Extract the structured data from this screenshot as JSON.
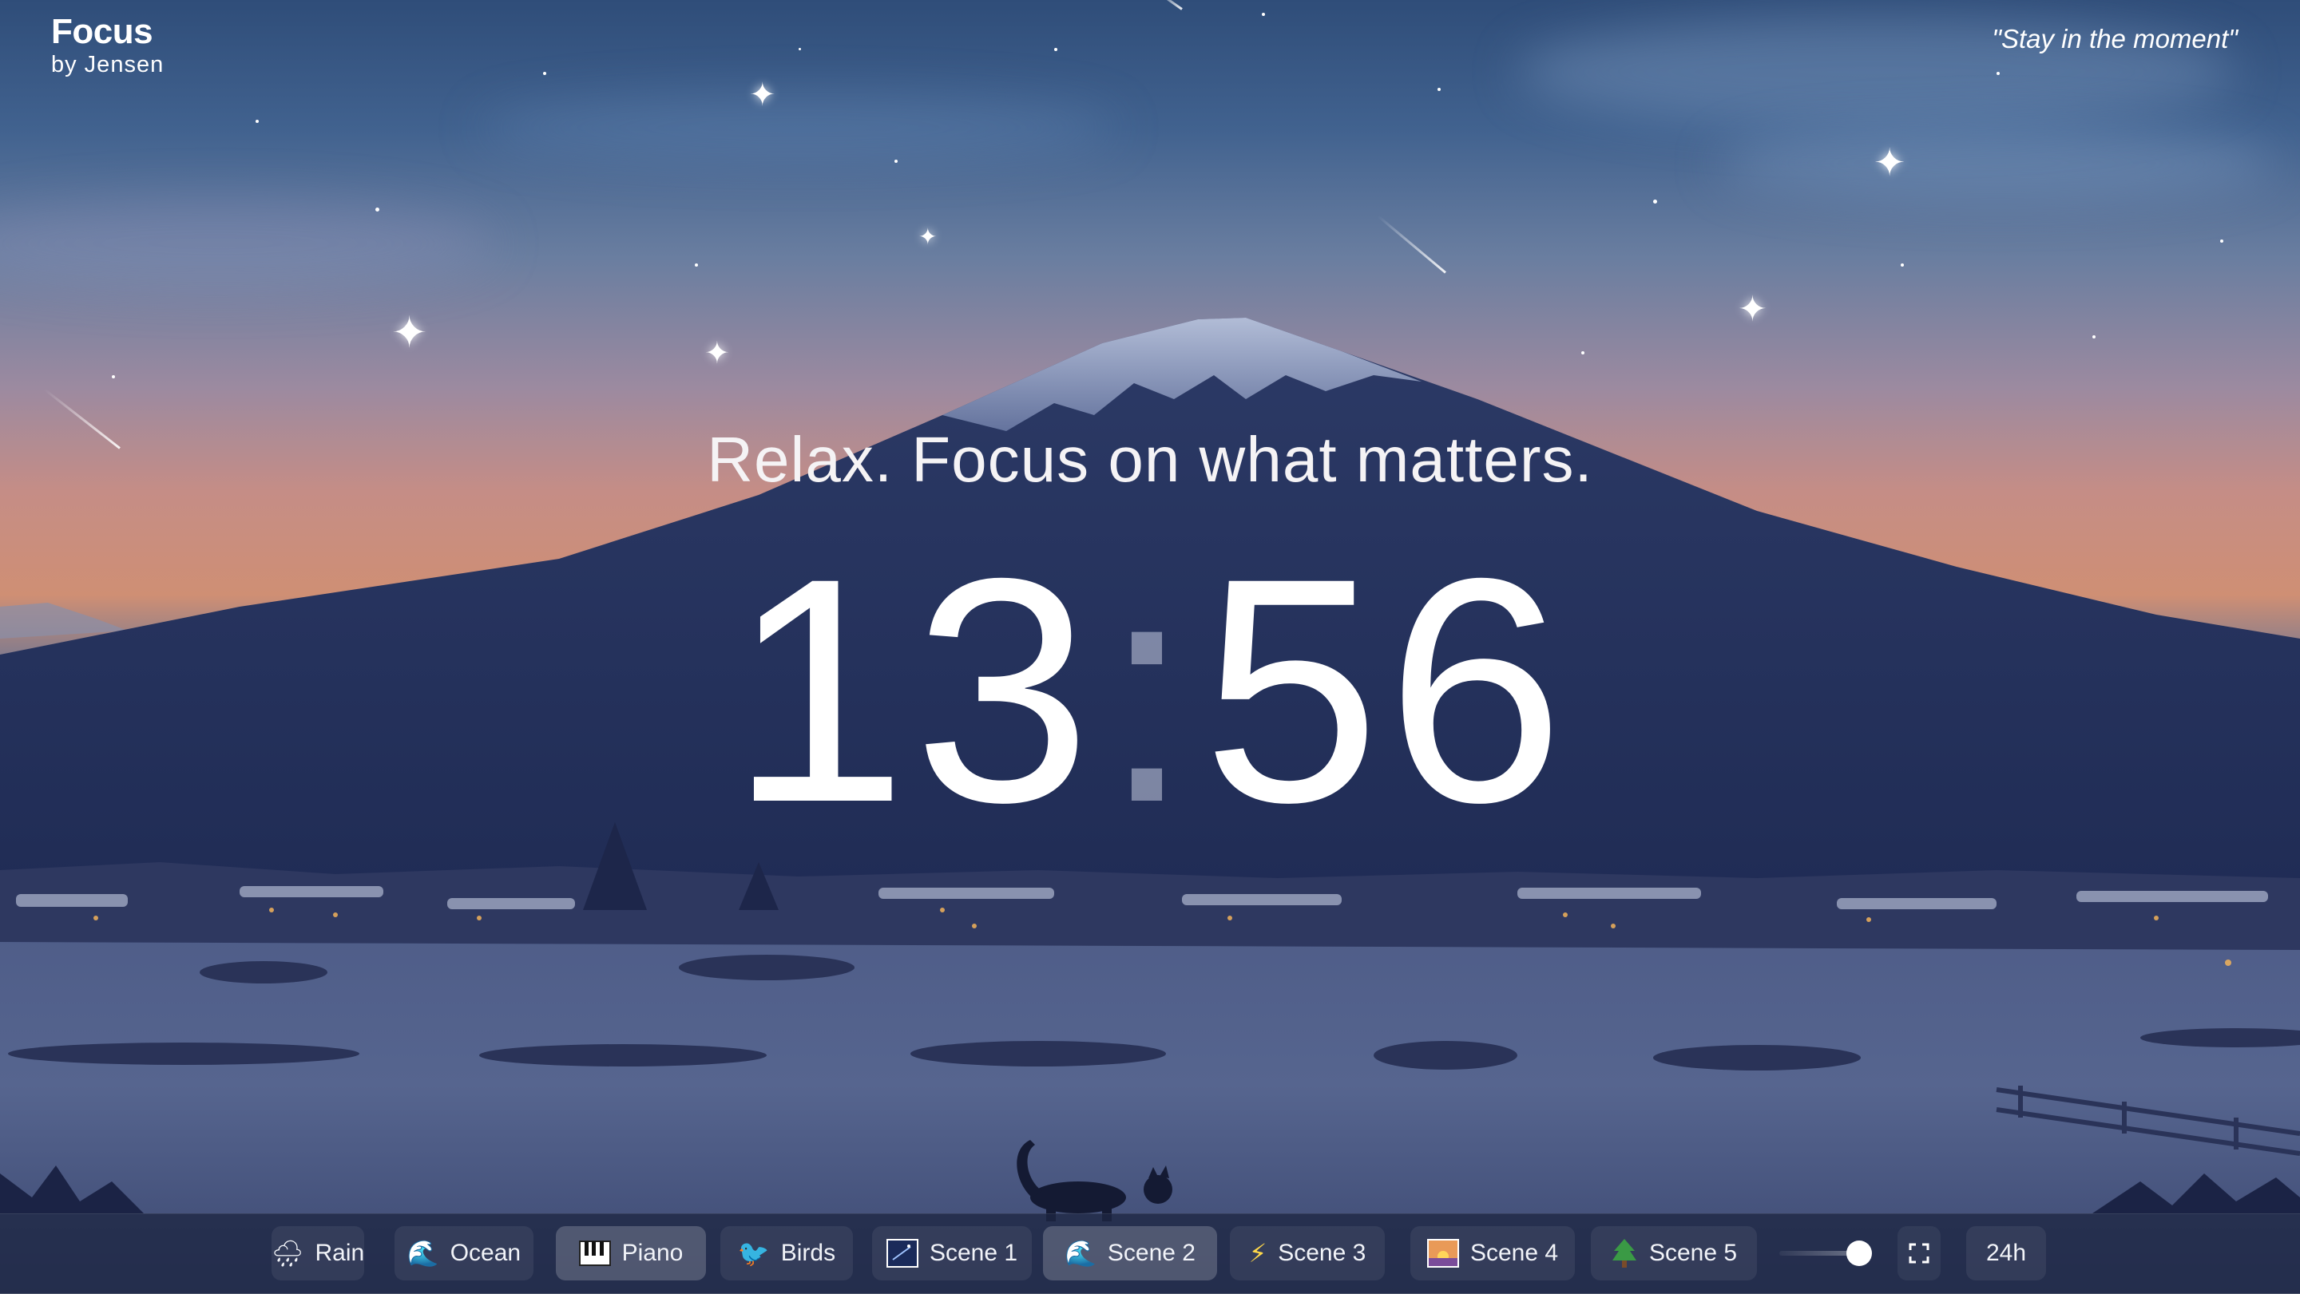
{
  "brand": {
    "title": "Focus",
    "subtitle": "by Jensen"
  },
  "quote": "\"Stay in the moment\"",
  "tagline": "Relax. Focus on what matters.",
  "clock": {
    "hours": "13",
    "separator": ":",
    "minutes": "56"
  },
  "sounds": [
    {
      "label": "Rain",
      "icon": "rain-cloud-icon",
      "active": false
    },
    {
      "label": "Ocean",
      "icon": "wave-icon",
      "active": false
    },
    {
      "label": "Piano",
      "icon": "piano-icon",
      "active": true
    },
    {
      "label": "Birds",
      "icon": "bird-icon",
      "active": false
    }
  ],
  "scenes": [
    {
      "label": "Scene 1",
      "icon": "night-sky-icon",
      "active": false
    },
    {
      "label": "Scene 2",
      "icon": "wave-icon",
      "active": true
    },
    {
      "label": "Scene 3",
      "icon": "lightning-icon",
      "active": false
    },
    {
      "label": "Scene 4",
      "icon": "sunrise-icon",
      "active": false
    },
    {
      "label": "Scene 5",
      "icon": "pine-tree-icon",
      "active": false
    }
  ],
  "volume": {
    "level": 0.85
  },
  "fullscreen_icon": "fullscreen-icon",
  "time_format_label": "24h"
}
